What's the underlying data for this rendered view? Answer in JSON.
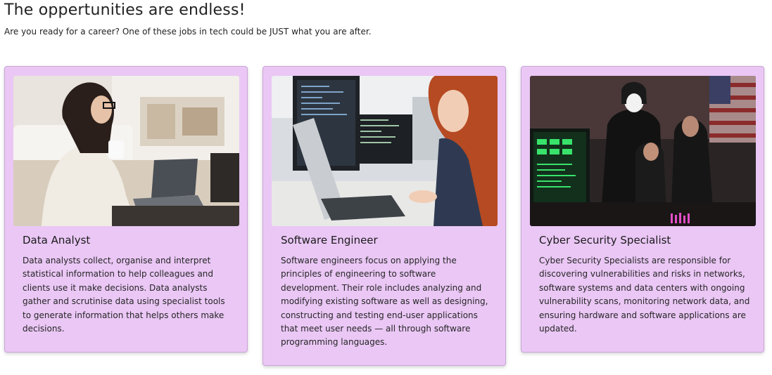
{
  "header": {
    "title": "The oppertunities are endless!",
    "subtitle": "Are you ready for a career? One of these jobs in tech could be JUST what you are after."
  },
  "cards": [
    {
      "title": "Data Analyst",
      "text": "Data analysts collect, organise and interpret statistical information to help colleagues and clients use it make decisions. Data analysts gather and scrutinise data using specialist tools to generate information that helps others make decisions.",
      "image": "woman-working-on-laptop-photo"
    },
    {
      "title": "Software Engineer",
      "text": "Software engineers focus on applying the principles of engineering to software development. Their role includes analyzing and modifying existing software as well as designing, constructing and testing end-user applications that meet user needs — all through software programming languages.",
      "image": "woman-at-computer-monitors-photo"
    },
    {
      "title": "Cyber Security Specialist",
      "text": "Cyber Security Specialists are responsible for discovering vulnerabilities and risks in networks, software systems and data centers with ongoing vulnerability scans, monitoring network data, and ensuring hardware and software applications are updated.",
      "image": "hooded-hackers-in-dark-room-photo"
    }
  ],
  "colors": {
    "card_background": "#eac7f5",
    "card_border": "#c9a6d6"
  }
}
